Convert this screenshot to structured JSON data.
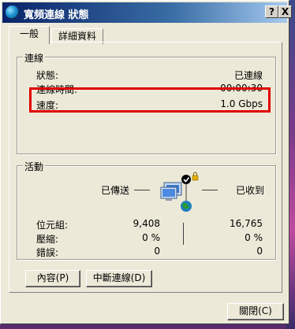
{
  "window": {
    "title": "寬頻連線 狀態",
    "help_glyph": "?",
    "close_glyph": "X"
  },
  "tabs": [
    {
      "label": "一般",
      "active": true
    },
    {
      "label": "詳細資料",
      "active": false
    }
  ],
  "connection": {
    "group_title": "連線",
    "rows": [
      {
        "label": "狀態:",
        "value": "已連線"
      },
      {
        "label": "連線時間:",
        "value": "00:00:30"
      },
      {
        "label": "速度:",
        "value": "1.0 Gbps"
      }
    ]
  },
  "activity": {
    "group_title": "活動",
    "sent_label": "已傳送",
    "received_label": "已收到",
    "rows": [
      {
        "label": "位元組:",
        "sent": "9,408",
        "received": "16,765"
      },
      {
        "label": "壓縮:",
        "sent": "0 %",
        "received": "0 %"
      },
      {
        "label": "錯誤:",
        "sent": "0",
        "received": "0"
      }
    ]
  },
  "buttons": {
    "properties": "內容(P)",
    "disconnect": "中斷連線(D)",
    "close": "關閉(C)"
  },
  "colors": {
    "highlight_box": "#e00000",
    "title_bar": "#0a246a",
    "dialog_face": "#ece9d8"
  }
}
